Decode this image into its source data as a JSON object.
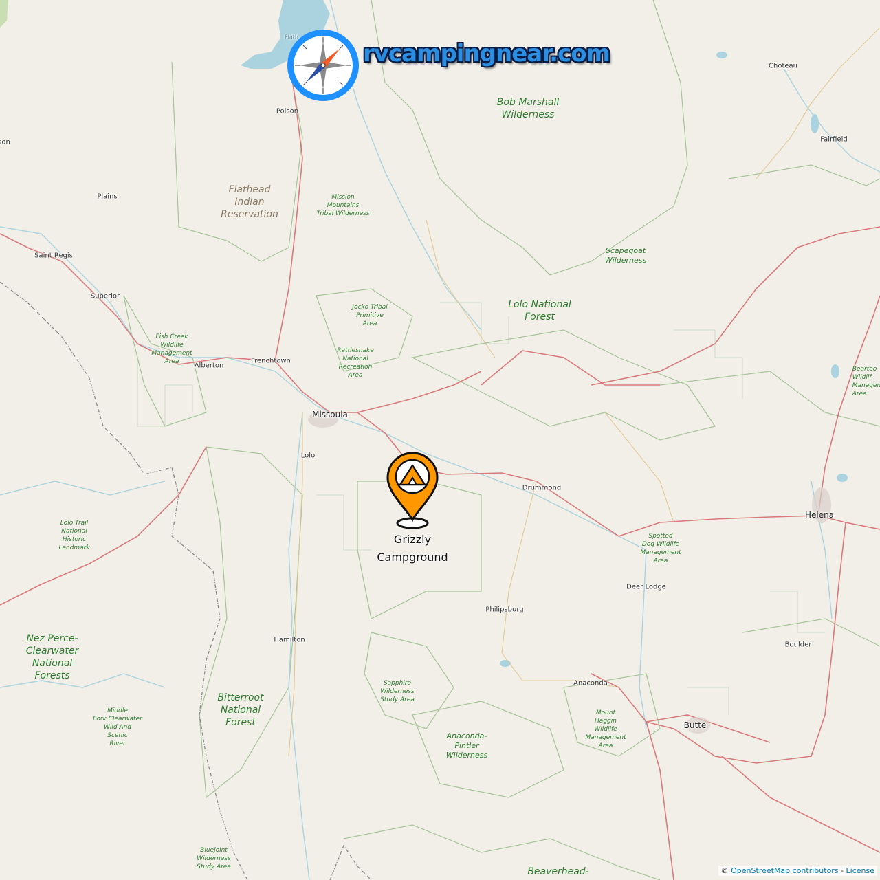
{
  "brand": {
    "logo_text": "rvcampingnear.com",
    "logo_icon": "compass-icon"
  },
  "marker": {
    "name_line1": "Grizzly",
    "name_line2": "Campground",
    "icon": "campground-pin-icon",
    "color": "#ff9800"
  },
  "places": [
    {
      "id": "polson",
      "label": "Polson"
    },
    {
      "id": "flathead",
      "label": "Flath"
    },
    {
      "id": "choteau",
      "label": "Choteau"
    },
    {
      "id": "fairfield",
      "label": "Fairfield"
    },
    {
      "id": "son",
      "label": "son"
    },
    {
      "id": "plains",
      "label": "Plains"
    },
    {
      "id": "saint-regis",
      "label": "Saint Regis"
    },
    {
      "id": "superior",
      "label": "Superior"
    },
    {
      "id": "alberton",
      "label": "Alberton"
    },
    {
      "id": "frenchtown",
      "label": "Frenchtown"
    },
    {
      "id": "missoula",
      "label": "Missoula"
    },
    {
      "id": "lolo",
      "label": "Lolo"
    },
    {
      "id": "drummond",
      "label": "Drummond"
    },
    {
      "id": "helena",
      "label": "Helena"
    },
    {
      "id": "deer-lodge",
      "label": "Deer Lodge"
    },
    {
      "id": "philipsburg",
      "label": "Philipsburg"
    },
    {
      "id": "hamilton",
      "label": "Hamilton"
    },
    {
      "id": "boulder",
      "label": "Boulder"
    },
    {
      "id": "anaconda",
      "label": "Anaconda"
    },
    {
      "id": "butte",
      "label": "Butte"
    }
  ],
  "areas": [
    {
      "id": "bob-marshall",
      "label": "Bob Marshall\nWilderness"
    },
    {
      "id": "flathead-res",
      "label": "Flathead\nIndian\nReservation"
    },
    {
      "id": "mission-mtns",
      "label": "Mission\nMountains\nTribal Wilderness"
    },
    {
      "id": "scapegoat",
      "label": "Scapegoat\nWilderness"
    },
    {
      "id": "jocko",
      "label": "Jocko Tribal\nPrimitive\nArea"
    },
    {
      "id": "lolo-nf",
      "label": "Lolo National\nForest"
    },
    {
      "id": "fish-creek",
      "label": "Fish Creek\nWildlife\nManagement\nArea"
    },
    {
      "id": "rattlesnake",
      "label": "Rattlesnake\nNational\nRecreation\nArea"
    },
    {
      "id": "beartooth",
      "label": "Beartoo\nWildlif\nManagem\nArea"
    },
    {
      "id": "lolo-trail",
      "label": "Lolo Trail\nNational\nHistoric\nLandmark"
    },
    {
      "id": "spotted-dog",
      "label": "Spotted\nDog Wildlife\nManagement\nArea"
    },
    {
      "id": "nez-perce",
      "label": "Nez Perce-\nClearwater\nNational\nForests"
    },
    {
      "id": "bitterroot",
      "label": "Bitterroot\nNational\nForest"
    },
    {
      "id": "sapphire",
      "label": "Sapphire\nWilderness\nStudy Area"
    },
    {
      "id": "middle-fork",
      "label": "Middle\nFork Clearwater\nWild And\nScenic\nRiver"
    },
    {
      "id": "mount-haggin",
      "label": "Mount\nHaggin\nWildlife\nManagement\nArea"
    },
    {
      "id": "anaconda-pintler",
      "label": "Anaconda-\nPintler\nWilderness"
    },
    {
      "id": "bluejoint",
      "label": "Bluejoint\nWilderness\nStudy Area"
    },
    {
      "id": "beaverhead",
      "label": "Beaverhead-"
    }
  ],
  "attribution": {
    "copy": "©",
    "osm": "OpenStreetMap contributors",
    "sep": " - ",
    "license": "License"
  },
  "colors": {
    "land": "#f2efe9",
    "water": "#aad3df",
    "boundary": "#9dbf8f",
    "road": "#d97a7a",
    "state_line": "#8a8a8a"
  }
}
